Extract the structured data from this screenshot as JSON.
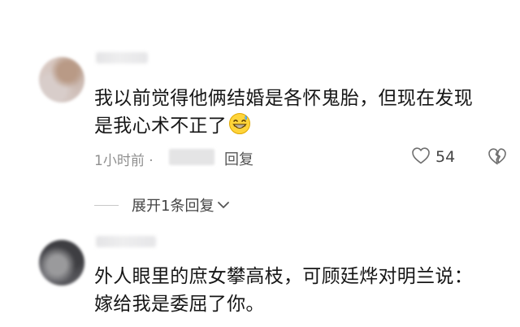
{
  "comments": [
    {
      "text_line1": "我以前觉得他俩结婚是各怀鬼胎，但现在发现",
      "text_line2": "是我心术不正了",
      "emoji": "grinning-sweat-emoji",
      "time": "1小时前 ·",
      "reply_label": "回复",
      "like_count": "54",
      "expand_label": "展开1条回复"
    },
    {
      "text_line1": "外人眼里的庶女攀高枝，可顾廷烨对明兰说：",
      "text_line2": "嫁给我是委屈了你。"
    }
  ],
  "icons": {
    "like": "heart-outline-icon",
    "dislike": "broken-heart-icon",
    "expand": "chevron-down-icon"
  },
  "colors": {
    "text": "#161616",
    "meta": "#8f8f8f",
    "background": "#ffffff"
  }
}
